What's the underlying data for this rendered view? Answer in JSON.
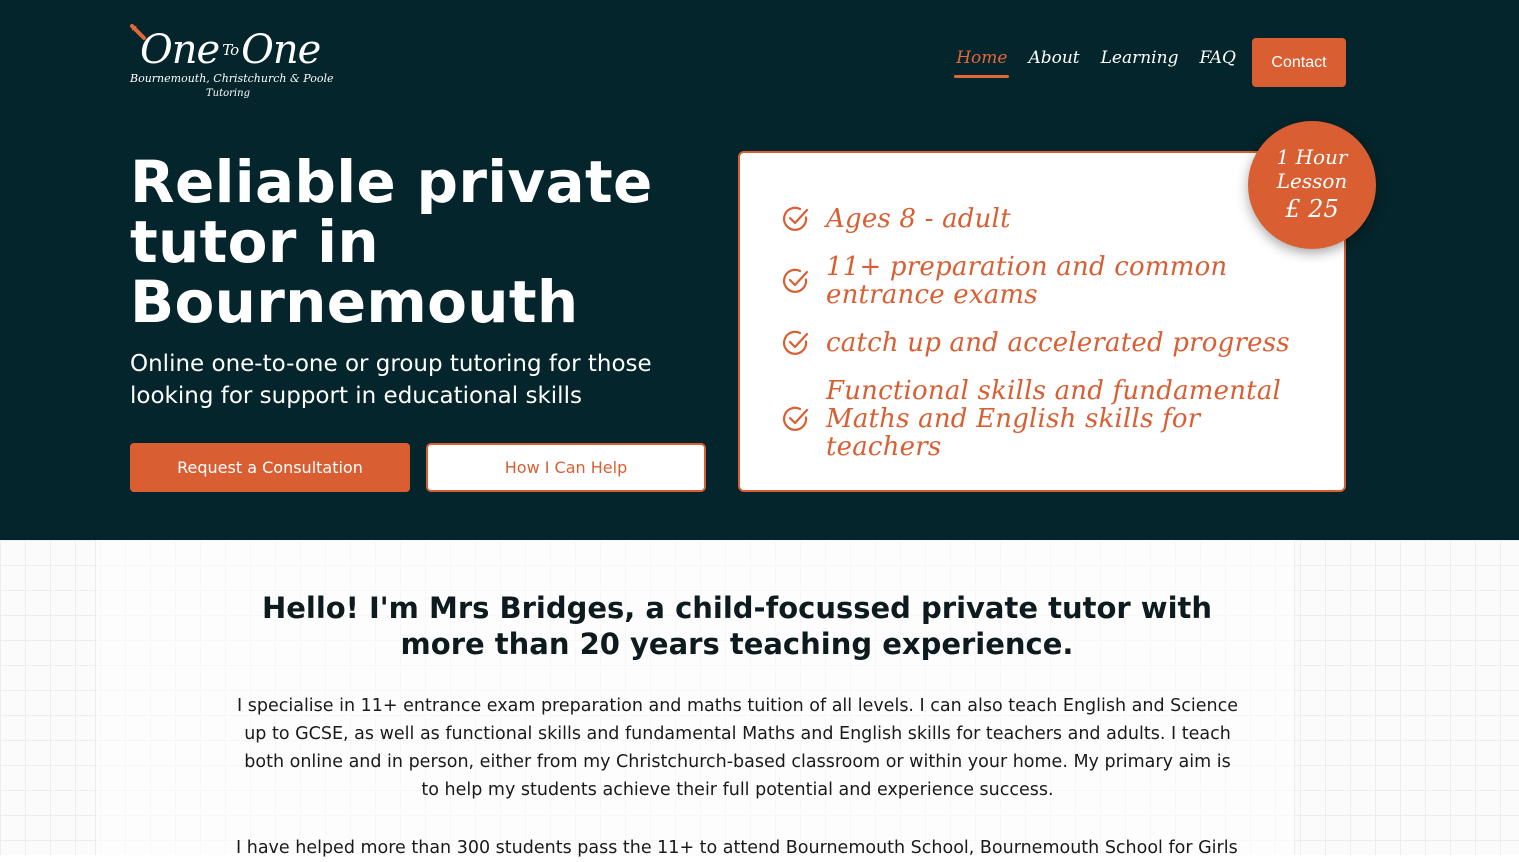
{
  "logo": {
    "main_left": "One",
    "main_to": "To",
    "main_right": "One",
    "sub": "Bournemouth, Christchurch & Poole",
    "sub2": "Tutoring"
  },
  "nav": {
    "items": [
      {
        "label": "Home",
        "active": true
      },
      {
        "label": "About",
        "active": false
      },
      {
        "label": "Learning",
        "active": false
      },
      {
        "label": "FAQ",
        "active": false
      }
    ],
    "contact_label": "Contact"
  },
  "hero": {
    "title": "Reliable private tutor in Bournemouth",
    "subtitle": "Online one-to-one or group tutoring for those looking for support in educational skills",
    "primary_button": "Request a Consultation",
    "secondary_button": "How I Can Help"
  },
  "features": {
    "items": [
      "Ages 8 - adult",
      "11+ preparation and common entrance exams",
      "catch up and accelerated progress",
      "Functional skills and fundamental Maths and English skills for teachers"
    ],
    "icon": "check-circle-icon"
  },
  "badge": {
    "line1": "1 Hour",
    "line2": "Lesson",
    "price": "£ 25"
  },
  "about": {
    "heading": "Hello! I'm Mrs Bridges, a child-focussed private tutor with more than 20 years teaching experience.",
    "paragraph1": "I specialise in 11+ entrance exam preparation and maths tuition of all levels. I can also teach English and Science up to GCSE, as well as functional skills and fundamental Maths and English skills for teachers and adults. I teach both online and in person, either from my Christchurch-based classroom or within your home. My primary aim is to help my students achieve their full potential and experience success.",
    "paragraph2": "I have helped more than 300 students pass the 11+ to attend Bournemouth School, Bournemouth School for Girls,"
  },
  "colors": {
    "hero_bg": "#04252b",
    "accent": "#d95f33",
    "white": "#ffffff"
  }
}
